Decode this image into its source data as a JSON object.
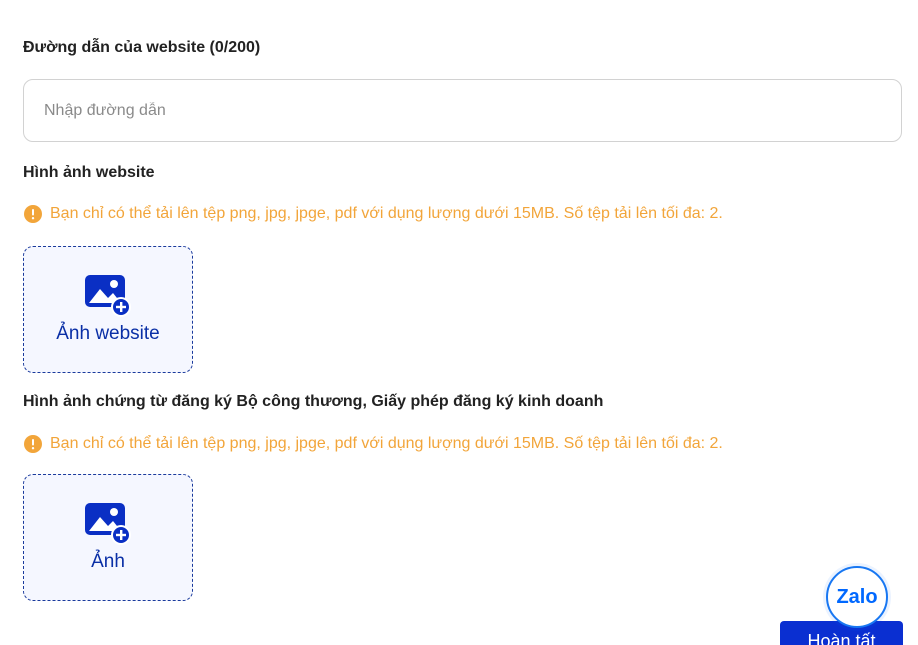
{
  "website_url": {
    "label": "Đường dẫn của website (0/200)",
    "placeholder": "Nhập đường dẫn",
    "value": ""
  },
  "website_image": {
    "label": "Hình ảnh website",
    "notice": "Bạn chỉ có thể tải lên tệp png, jpg, jpge, pdf với dụng lượng dưới 15MB. Số tệp tải lên tối đa: 2.",
    "upload_label": "Ảnh website"
  },
  "license_image": {
    "label": "Hình ảnh chứng từ đăng ký Bộ công thương, Giấy phép đăng ký kinh doanh",
    "notice": "Bạn chỉ có thể tải lên tệp png, jpg, jpge, pdf với dụng lượng dưới 15MB. Số tệp tải lên tối đa: 2.",
    "upload_label": "Ảnh"
  },
  "zalo": {
    "label": "Zalo"
  },
  "footer": {
    "finish_label": "Hoàn tất"
  },
  "colors": {
    "accent": "#0a2fd1",
    "warning": "#f2a53a",
    "upload_border": "#1a3a9c",
    "upload_bg": "#f5f7ff"
  },
  "icons": {
    "warning": "warning-circle-icon",
    "image_add": "image-add-icon"
  }
}
